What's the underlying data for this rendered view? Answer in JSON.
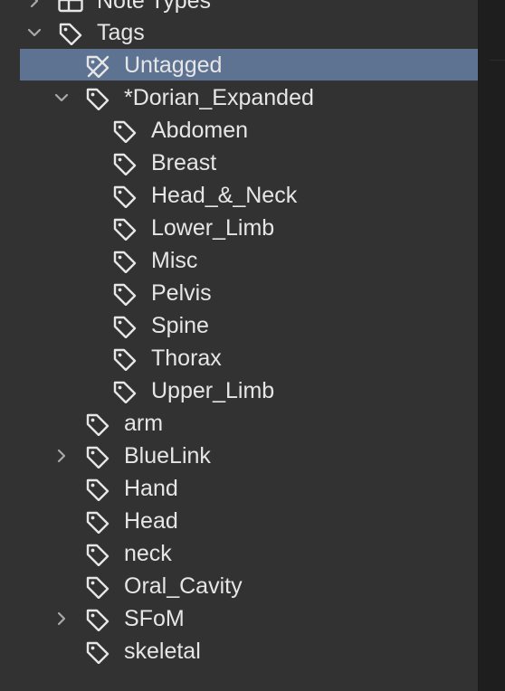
{
  "sidebar": {
    "note_types_label": "Note Types",
    "tags_label": "Tags",
    "untagged_label": "Untagged",
    "dorian": {
      "label": "*Dorian_Expanded",
      "children": [
        "Abdomen",
        "Breast",
        "Head_&_Neck",
        "Lower_Limb",
        "Misc",
        "Pelvis",
        "Spine",
        "Thorax",
        "Upper_Limb"
      ]
    },
    "tags": [
      "arm",
      "BlueLink",
      "Hand",
      "Head",
      "neck",
      "Oral_Cavity",
      "SFoM",
      "skeletal"
    ]
  },
  "colors": {
    "sidebar_bg": "#323232",
    "selection": "#5d7391",
    "text": "#e6e6e6"
  }
}
